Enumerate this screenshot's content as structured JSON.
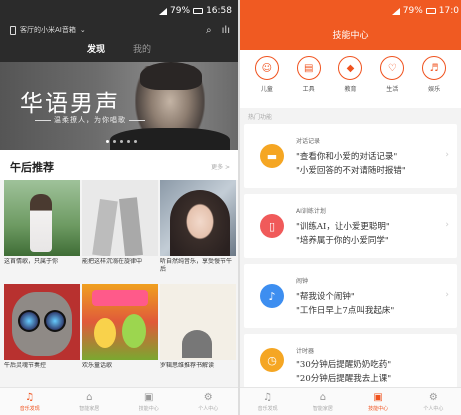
{
  "left": {
    "status": {
      "battery": "79%",
      "time": "16:58"
    },
    "device": {
      "label": "客厅的小米AI音箱"
    },
    "tabs": [
      {
        "label": "发现"
      },
      {
        "label": "我的"
      }
    ],
    "banner": {
      "title": "华语男声",
      "subtitle": "温柔撩人，为你唱歌"
    },
    "recommend": {
      "title": "午后推荐",
      "more": "更多 >"
    },
    "tiles": [
      {
        "caption": "这首情歌，只属于你"
      },
      {
        "caption": "能把这样沉溺在旋律中"
      },
      {
        "caption": "听自然纯音乐，享受慢节午后"
      },
      {
        "caption": "午后灵魂节奏控"
      },
      {
        "caption": "欢乐童话歌"
      },
      {
        "caption": "罗辑思维推荐书解读"
      }
    ],
    "nav": [
      {
        "label": "音乐发现",
        "icon": "music-icon"
      },
      {
        "label": "智能家居",
        "icon": "home-icon"
      },
      {
        "label": "技能中心",
        "icon": "skill-icon"
      },
      {
        "label": "个人中心",
        "icon": "settings-icon"
      }
    ]
  },
  "right": {
    "status": {
      "battery": "79%",
      "time": "17:0"
    },
    "title": "技能中心",
    "categories": [
      {
        "label": "儿童",
        "icon": "child-icon"
      },
      {
        "label": "工具",
        "icon": "toolbox-icon"
      },
      {
        "label": "教育",
        "icon": "graduation-icon"
      },
      {
        "label": "生活",
        "icon": "life-icon"
      },
      {
        "label": "娱乐",
        "icon": "entertainment-icon"
      }
    ],
    "section": "热门功能",
    "cards": [
      {
        "name": "对话记录",
        "line1": "\"查看你和小爱的对话记录\"",
        "line2": "\"小爱回答的不对请随时报错\"",
        "color": "#f5a623",
        "icon": "chat-icon"
      },
      {
        "name": "AI训练计划",
        "line1": "\"训练AI，让小爱更聪明\"",
        "line2": "\"培养属于你的小爱同学\"",
        "color": "#f05a5a",
        "icon": "ai-training-icon"
      },
      {
        "name": "闹钟",
        "line1": "\"帮我设个闹钟\"",
        "line2": "\"工作日早上7点叫我起床\"",
        "color": "#3d8ef0",
        "icon": "bell-icon"
      },
      {
        "name": "计时器",
        "line1": "\"30分钟后提醒奶奶吃药\"",
        "line2": "\"20分钟后提醒我去上课\"",
        "color": "#f5a623",
        "icon": "timer-icon"
      }
    ],
    "nav": [
      {
        "label": "音乐发现",
        "icon": "music-icon"
      },
      {
        "label": "智能家居",
        "icon": "home-icon"
      },
      {
        "label": "技能中心",
        "icon": "skill-icon"
      },
      {
        "label": "个人中心",
        "icon": "settings-icon"
      }
    ]
  },
  "colors": {
    "accent": "#f0521e",
    "dark_header": "#2b2b2b",
    "skill_header": "#f05a22"
  }
}
